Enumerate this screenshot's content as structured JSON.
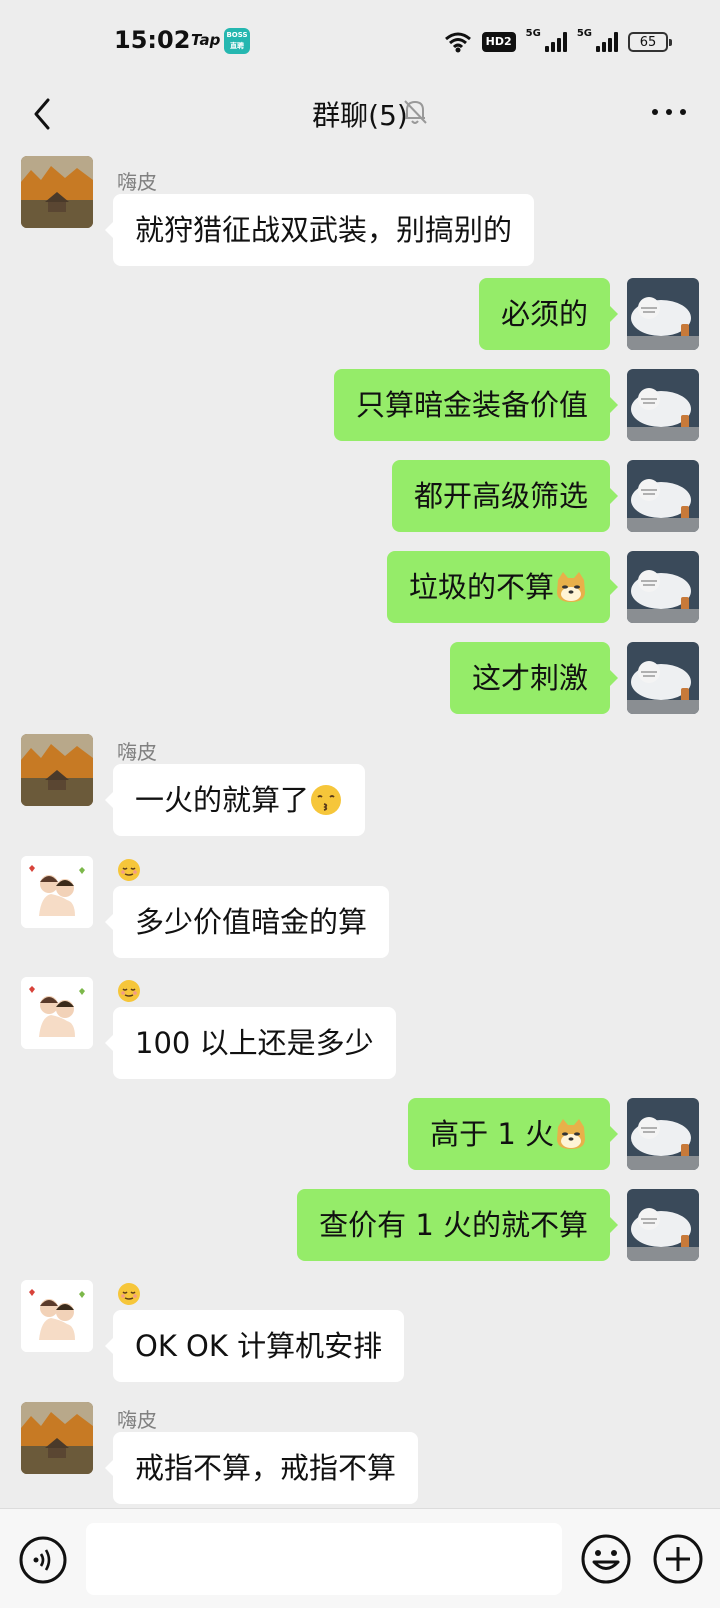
{
  "status_bar": {
    "time": "15:02",
    "tap_label": "Tap",
    "boss_badge": "BOSS 直聘",
    "hd_label": "HD2",
    "net1": "5G",
    "net2": "5G",
    "battery": "65"
  },
  "header": {
    "title": "群聊(5)"
  },
  "messages": [
    {
      "side": "left",
      "sender": "嗨皮",
      "text": "就狩猎征战双武装，别搞别的"
    },
    {
      "side": "right",
      "text": "必须的"
    },
    {
      "side": "right",
      "text": "只算暗金装备价值"
    },
    {
      "side": "right",
      "text": "都开高级筛选"
    },
    {
      "side": "right",
      "text": "垃圾的不算",
      "emoji": "doge-emoji"
    },
    {
      "side": "right",
      "text": "这才刺激"
    },
    {
      "side": "left",
      "sender": "嗨皮",
      "text": "一火的就算了",
      "emoji": "kissing-face-emoji"
    },
    {
      "side": "left",
      "sender_emoji": "relieved-face-emoji",
      "text": "多少价值暗金的算"
    },
    {
      "side": "left",
      "sender_emoji": "relieved-face-emoji",
      "text": "100 以上还是多少"
    },
    {
      "side": "right",
      "text": "高于 1 火",
      "emoji": "doge-emoji"
    },
    {
      "side": "right",
      "text": "查价有 1 火的就不算"
    },
    {
      "side": "left",
      "sender_emoji": "relieved-face-emoji",
      "text": "OK OK 计算机安排"
    },
    {
      "side": "left",
      "sender": "嗨皮",
      "text": "戒指不算，戒指不算"
    }
  ],
  "colors": {
    "background": "#ededed",
    "bubble_out": "#95ec69",
    "bubble_in": "#ffffff"
  }
}
